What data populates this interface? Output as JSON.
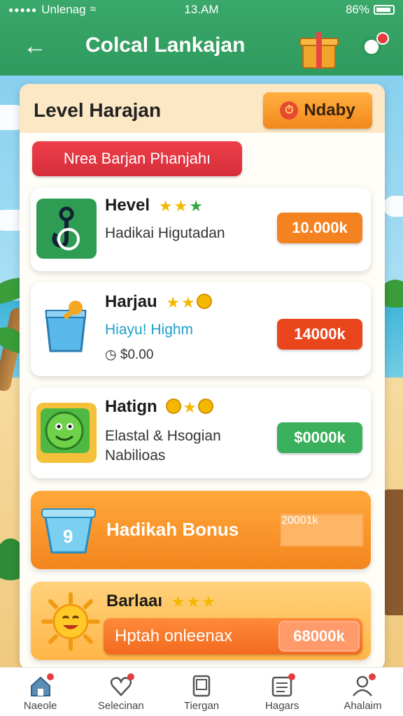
{
  "status_bar": {
    "carrier": "Unlenag",
    "time": "13.AM",
    "battery": "86%"
  },
  "header": {
    "title": "Colcal Lankajan",
    "back_icon": "arrow-left-icon",
    "gift_icon": "gift-icon",
    "notification_icon": "notification-icon"
  },
  "panel": {
    "title": "Level Harajan",
    "today_button": "Ndaby",
    "banner": "Nrea Barjan Phanjahı"
  },
  "cards": [
    {
      "name": "Hevel",
      "subtitle": "Hadikai Higutadan",
      "price": "10.000k",
      "price_color": "#f58220",
      "thumb_color": "#2e9c52",
      "icon": "hook-icon"
    },
    {
      "name": "Harjau",
      "subtitle": "Hiayu! Highm",
      "extra": "$0.00",
      "price": "14000k",
      "price_color": "#e9461e",
      "thumb_color": "#5ab8ea",
      "icon": "cup-icon"
    },
    {
      "name": "Hatign",
      "subtitle": "Elastal & Hsogian",
      "subtitle2": "Nabilioas",
      "price": "$0000k",
      "price_color": "#3bb05c",
      "thumb_color": "#58b846",
      "icon": "frog-icon"
    }
  ],
  "bonus": {
    "label": "Hadikah Bonus",
    "value": "20001k",
    "icon": "bucket-icon"
  },
  "promo": {
    "title": "Barlaaı",
    "button": "Hptah onleenax",
    "value": "68000k",
    "icon": "sun-icon"
  },
  "bottom_nav": [
    {
      "label": "Naeole",
      "icon": "home-icon",
      "badge": true
    },
    {
      "label": "Selecinan",
      "icon": "heart-icon",
      "badge": true
    },
    {
      "label": "Tiergan",
      "icon": "tablet-icon",
      "badge": false
    },
    {
      "label": "Hagars",
      "icon": "list-icon",
      "badge": true
    },
    {
      "label": "Ahalaim",
      "icon": "user-icon",
      "badge": true
    }
  ]
}
